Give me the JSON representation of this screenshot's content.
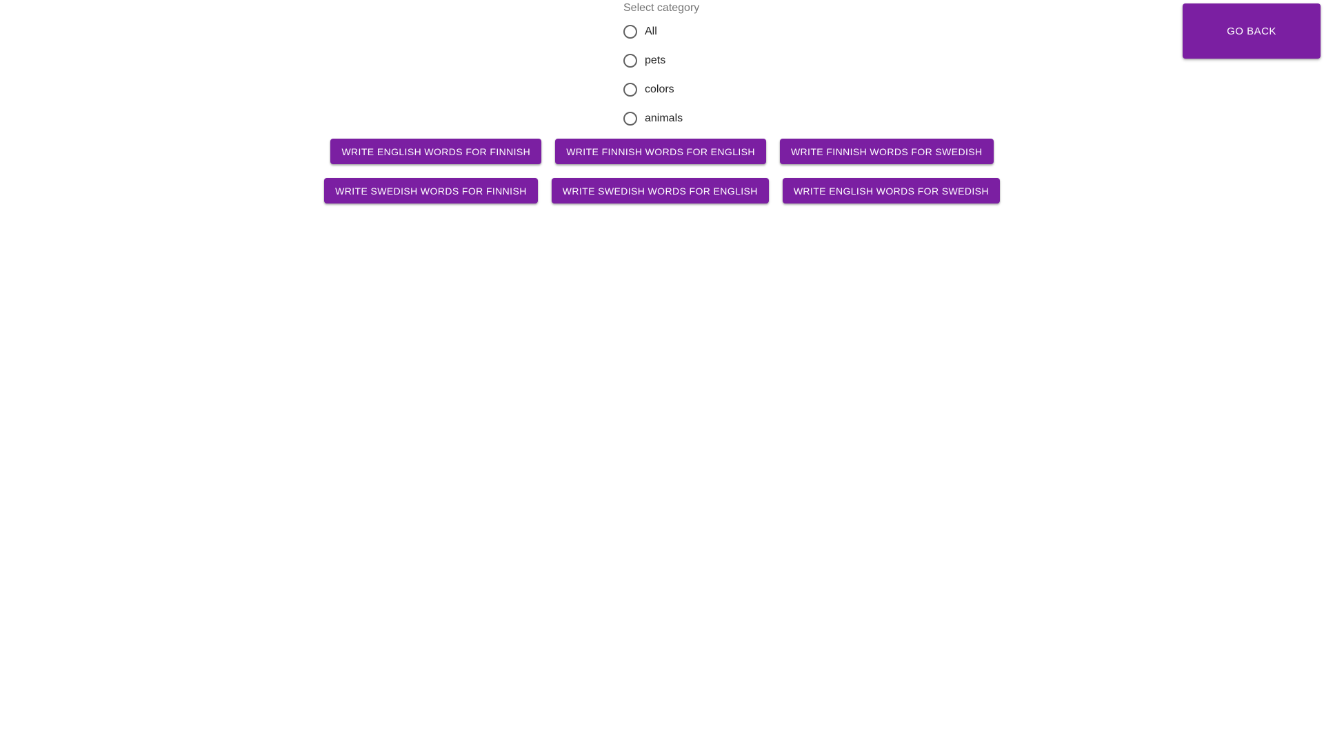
{
  "header": {
    "go_back_label": "GO BACK"
  },
  "category": {
    "label": "Select category",
    "options": [
      {
        "label": "All",
        "selected": false
      },
      {
        "label": "pets",
        "selected": false
      },
      {
        "label": "colors",
        "selected": false
      },
      {
        "label": "animals",
        "selected": false
      }
    ]
  },
  "actions": {
    "row1": [
      "WRITE ENGLISH WORDS FOR FINNISH",
      "WRITE FINNISH WORDS FOR ENGLISH",
      "WRITE FINNISH WORDS FOR SWEDISH"
    ],
    "row2": [
      "WRITE SWEDISH WORDS FOR FINNISH",
      "WRITE SWEDISH WORDS FOR ENGLISH",
      "WRITE ENGLISH WORDS FOR SWEDISH"
    ]
  },
  "colors": {
    "accent": "#7b1fa2",
    "button_text": "#ffffff",
    "label_gray": "#757575"
  }
}
